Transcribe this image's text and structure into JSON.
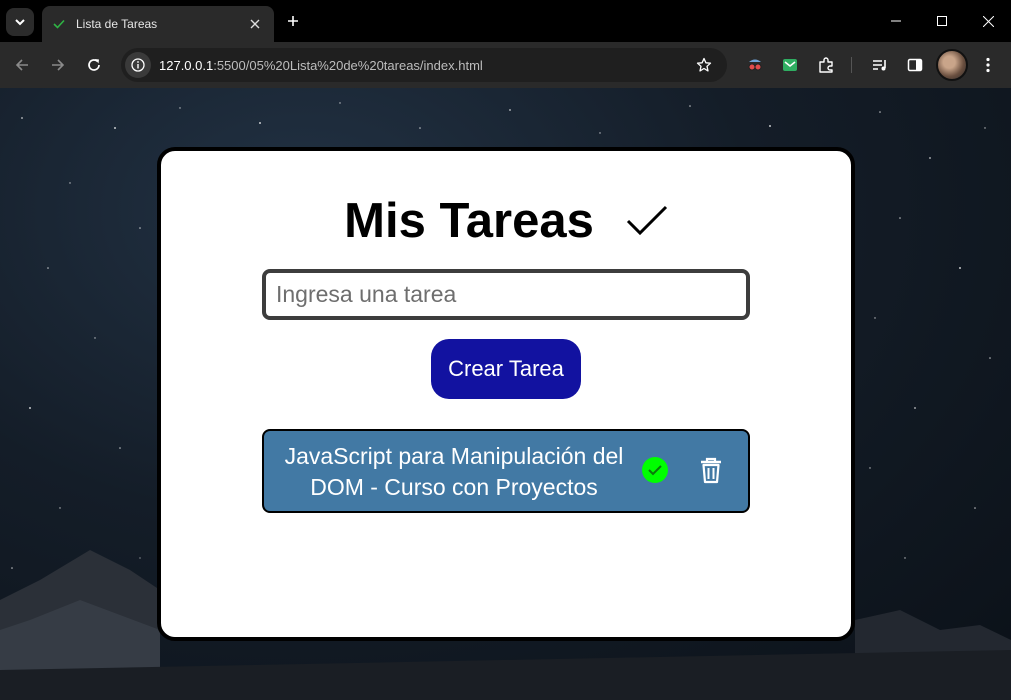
{
  "browser": {
    "tab": {
      "title": "Lista de Tareas"
    },
    "address": {
      "host": "127.0.0.1",
      "path": ":5500/05%20Lista%20de%20tareas/index.html"
    }
  },
  "app": {
    "heading": "Mis Tareas",
    "input": {
      "placeholder": "Ingresa una tarea",
      "value": ""
    },
    "create_button": "Crear Tarea",
    "tasks": [
      {
        "text": "JavaScript para Manipulación del DOM - Curso con Proyectos",
        "done_icon": "check-circle-icon",
        "delete_icon": "trash-icon"
      }
    ]
  },
  "colors": {
    "card_background": "#ffffff",
    "create_button": "#1212a0",
    "task_background": "#4279a4",
    "done_icon": "#00ff00"
  }
}
